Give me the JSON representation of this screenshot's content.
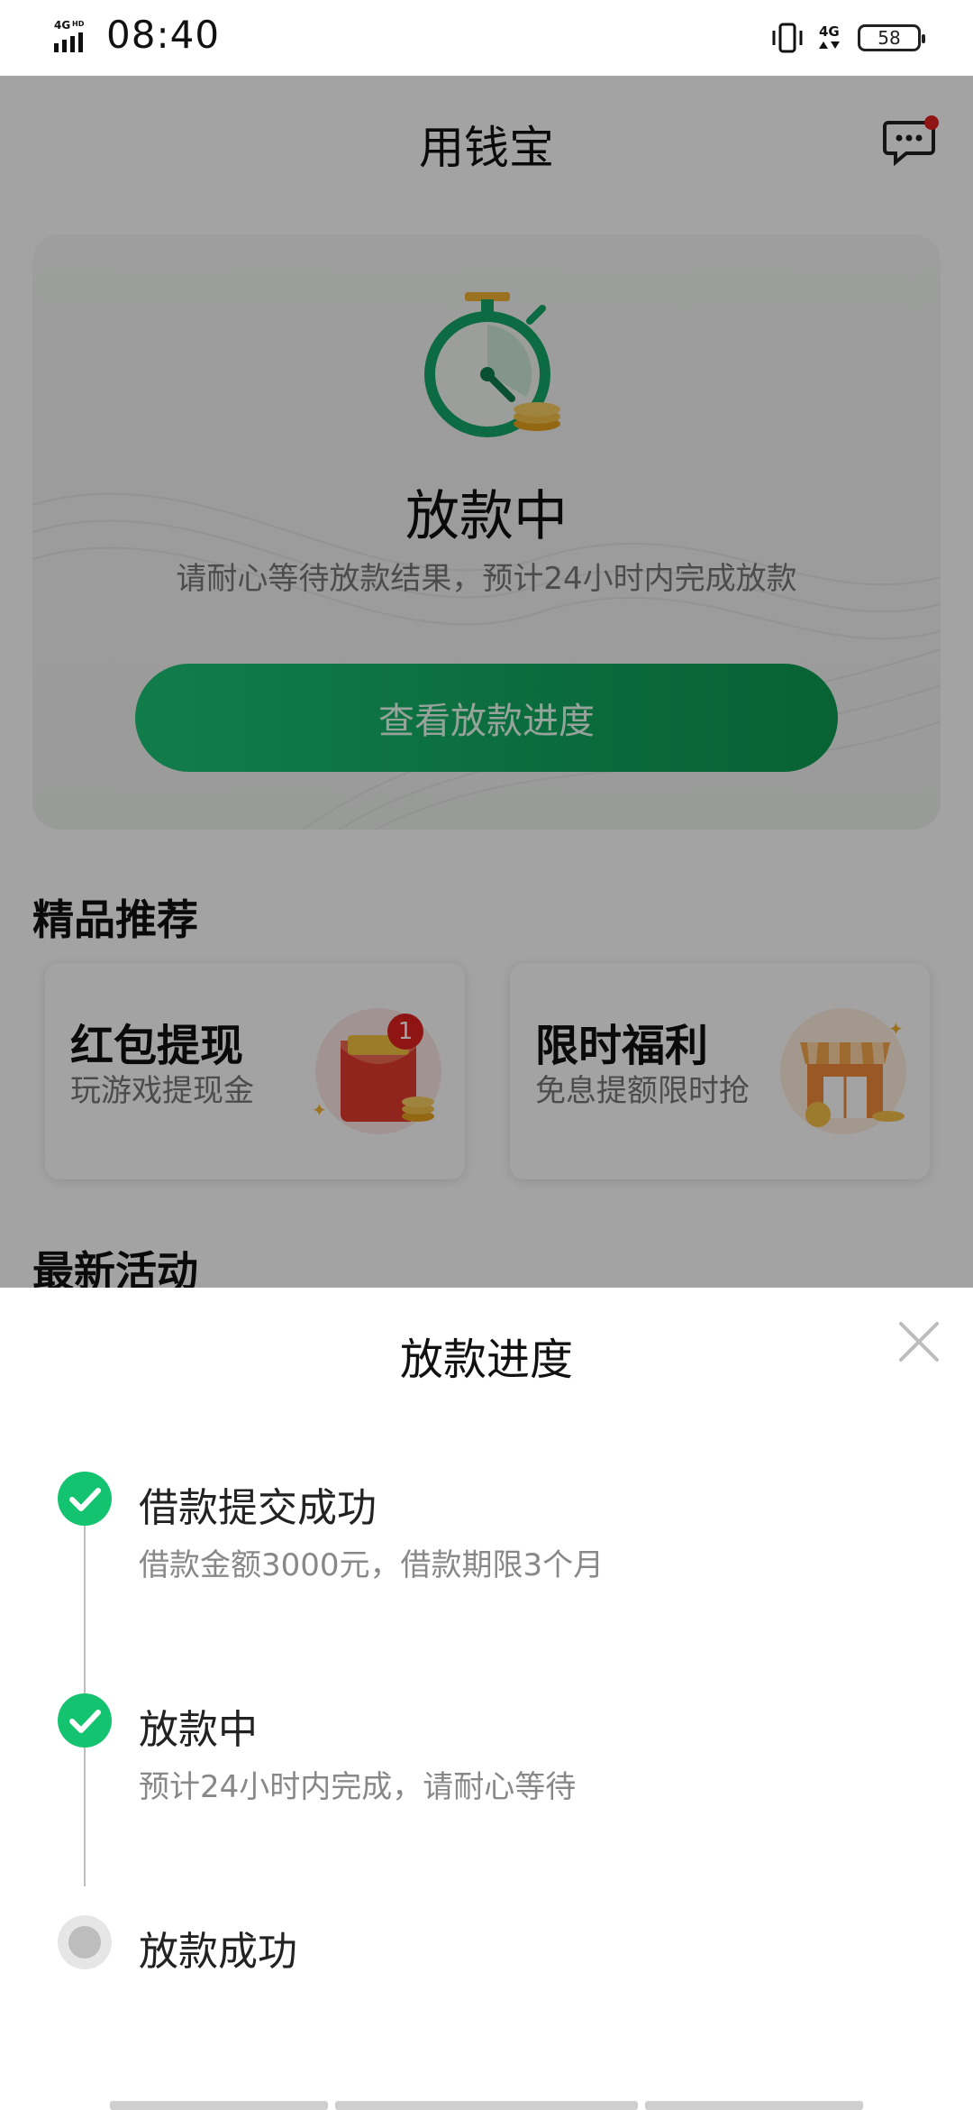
{
  "status_bar": {
    "network_left": "4G HD",
    "time": "08:40",
    "network_right": "4G",
    "battery": "58"
  },
  "header": {
    "title": "用钱宝",
    "message_icon": "chat-icon"
  },
  "status_card": {
    "title": "放款中",
    "description": "请耐心等待放款结果，预计24小时内完成放款",
    "button_label": "查看放款进度"
  },
  "recommend": {
    "title": "精品推荐",
    "items": [
      {
        "title": "红包提现",
        "subtitle": "玩游戏提现金",
        "badge": "1"
      },
      {
        "title": "限时福利",
        "subtitle": "免息提额限时抢"
      }
    ]
  },
  "activity": {
    "title": "最新活动"
  },
  "sheet": {
    "title": "放款进度",
    "steps": [
      {
        "title": "借款提交成功",
        "desc": "借款金额3000元，借款期限3个月",
        "status": "done"
      },
      {
        "title": "放款中",
        "desc": "预计24小时内完成，请耐心等待",
        "status": "done"
      },
      {
        "title": "放款成功",
        "desc": "",
        "status": "pending"
      }
    ]
  },
  "colors": {
    "accent_green": "#14c36f",
    "button_green": "#11a85e",
    "badge_red": "#e02020"
  }
}
